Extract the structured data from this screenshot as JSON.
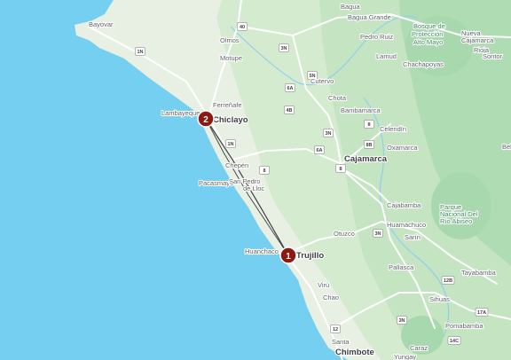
{
  "map": {
    "colors": {
      "ocean": "#75cff0",
      "land": "#e8f0e4",
      "highland": "#c9e6c9",
      "park": "#b7dfb9",
      "road": "#ffffff",
      "route": "#555555",
      "marker": "#8b1a10"
    },
    "markers": [
      {
        "label": "1"
      },
      {
        "label": "2"
      }
    ],
    "places": [
      {
        "name": "Bayovar"
      },
      {
        "name": "Olmos"
      },
      {
        "name": "Motupe"
      },
      {
        "name": "Bagua"
      },
      {
        "name": "Bagua Grande"
      },
      {
        "name": "Bosque de"
      },
      {
        "name": "Protección"
      },
      {
        "name": "Alto Mayo"
      },
      {
        "name": "Nueva"
      },
      {
        "name": "Cajamarca"
      },
      {
        "name": "Rioja"
      },
      {
        "name": "Sontor"
      },
      {
        "name": "Pedro Ruiz"
      },
      {
        "name": "Lamud"
      },
      {
        "name": "Chachapoyas"
      },
      {
        "name": "Cutervo"
      },
      {
        "name": "Chota"
      },
      {
        "name": "Ferreñafe"
      },
      {
        "name": "Lambayeque"
      },
      {
        "name": "Chiclayo"
      },
      {
        "name": "Bambamarca"
      },
      {
        "name": "Celendín"
      },
      {
        "name": "Oxamarca"
      },
      {
        "name": "Cajamarca"
      },
      {
        "name": "Chepén"
      },
      {
        "name": "Pacasmayo"
      },
      {
        "name": "San Pedro"
      },
      {
        "name": "de Lloc"
      },
      {
        "name": "Cajabamba"
      },
      {
        "name": "Huamachuco"
      },
      {
        "name": "Sarín"
      },
      {
        "name": "Parque"
      },
      {
        "name": "Nacional Del"
      },
      {
        "name": "Río Abiseo"
      },
      {
        "name": "Otuzco"
      },
      {
        "name": "Huanchaco"
      },
      {
        "name": "Trujillo"
      },
      {
        "name": "Pallasca"
      },
      {
        "name": "Tayabamba"
      },
      {
        "name": "Virú"
      },
      {
        "name": "Chao"
      },
      {
        "name": "Sihuas"
      },
      {
        "name": "Pomabamba"
      },
      {
        "name": "Santa"
      },
      {
        "name": "Chimbote"
      },
      {
        "name": "Caraz"
      },
      {
        "name": "Yungay"
      },
      {
        "name": "Bel"
      }
    ],
    "shields": [
      "1N",
      "40",
      "3N",
      "5N",
      "6A",
      "4B",
      "3N",
      "8B",
      "1N",
      "8",
      "6A",
      "8",
      "8",
      "3N",
      "12B",
      "3N",
      "12",
      "14C",
      "17A"
    ]
  }
}
